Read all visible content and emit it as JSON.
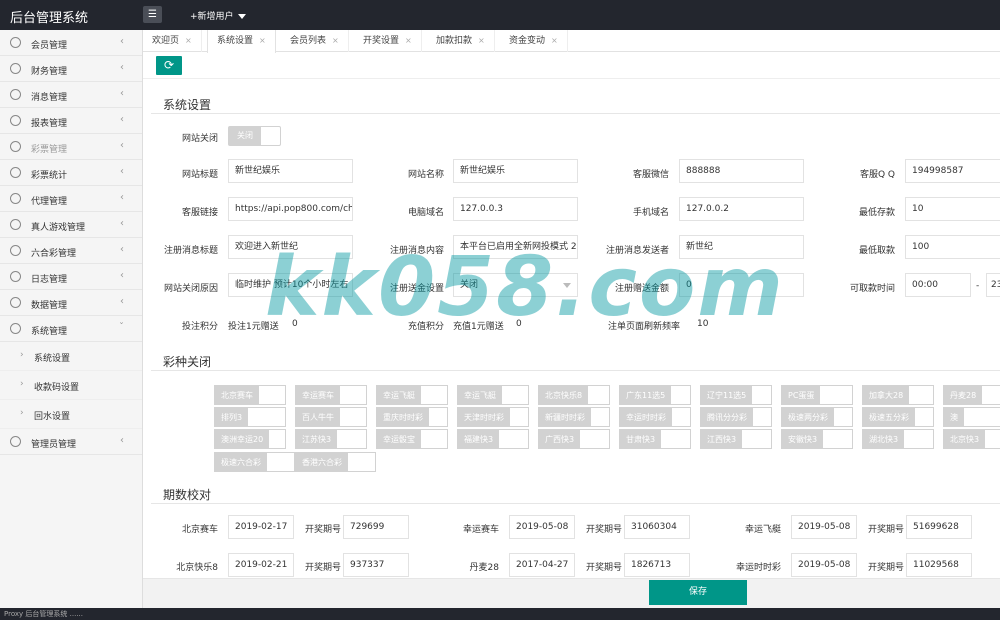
{
  "app": {
    "title": "后台管理系统",
    "add_user": "+新增用户"
  },
  "sidebar": {
    "items": [
      {
        "label": "会员管理"
      },
      {
        "label": "财务管理"
      },
      {
        "label": "消息管理"
      },
      {
        "label": "报表管理"
      },
      {
        "label": "彩票管理"
      },
      {
        "label": "彩票统计"
      },
      {
        "label": "代理管理"
      },
      {
        "label": "真人游戏管理"
      },
      {
        "label": "六合彩管理"
      },
      {
        "label": "日志管理"
      },
      {
        "label": "数据管理"
      },
      {
        "label": "系统管理"
      },
      {
        "label": "系统设置"
      },
      {
        "label": "收款码设置"
      },
      {
        "label": "回水设置"
      },
      {
        "label": "管理员管理"
      }
    ]
  },
  "tabs": [
    {
      "label": "欢迎页"
    },
    {
      "label": "系统设置"
    },
    {
      "label": "会员列表"
    },
    {
      "label": "开奖设置"
    },
    {
      "label": "加款扣款"
    },
    {
      "label": "资金变动"
    }
  ],
  "tab_close": "×",
  "refresh": "⟳",
  "settings": {
    "title": "系统设置",
    "site_close": {
      "label": "网站关闭",
      "value": "关闭"
    },
    "fields": [
      {
        "label": "网站标题",
        "value": "新世纪娱乐"
      },
      {
        "label": "网站名称",
        "value": "新世纪娱乐"
      },
      {
        "label": "客服微信",
        "value": "888888"
      },
      {
        "label": "客服Q Q",
        "value": "194998587"
      },
      {
        "label": "客服链接",
        "value": "https://api.pop800.com/chat/i"
      },
      {
        "label": "电脑域名",
        "value": "127.0.0.3"
      },
      {
        "label": "手机域名",
        "value": "127.0.0.2"
      },
      {
        "label": "最低存款",
        "value": "10"
      },
      {
        "label": "注册消息标题",
        "value": "欢迎进入新世纪"
      },
      {
        "label": "注册消息内容",
        "value": "本平台已启用全新网投模式 2"
      },
      {
        "label": "注册消息发送者",
        "value": "新世纪"
      },
      {
        "label": "最低取款",
        "value": "100"
      },
      {
        "label": "网站关闭原因",
        "value": "临时维护 预计10个小时左右"
      },
      {
        "label": "注册送金设置",
        "value": "关闭"
      },
      {
        "label": "注册赠送金额",
        "value": "0"
      },
      {
        "label": "可取款时间",
        "value": "00:00",
        "sep": "-",
        "value2": "23"
      }
    ],
    "points": [
      {
        "label": "投注积分",
        "prefix": "投注1元赠送",
        "value": "0"
      },
      {
        "label": "充值积分",
        "prefix": "充值1元赠送",
        "value": "0"
      },
      {
        "label": "注单页面刷新频率",
        "value": "10"
      }
    ]
  },
  "lottery": {
    "title": "彩种关闭",
    "rows": [
      [
        "北京赛车",
        "幸运赛车",
        "幸运飞艇",
        "幸运飞艇",
        "北京快乐8",
        "广东11选5",
        "辽宁11选5",
        "PC蛋蛋",
        "加拿大28",
        "丹麦28"
      ],
      [
        "排列3",
        "百人牛牛",
        "重庆时时彩",
        "天津时时彩",
        "新疆时时彩",
        "幸运时时彩",
        "腾讯分分彩",
        "极速两分彩",
        "极速五分彩",
        "澳"
      ],
      [
        "澳洲幸运20",
        "江苏快3",
        "幸运骰宝",
        "福建快3",
        "广西快3",
        "甘肃快3",
        "江西快3",
        "安徽快3",
        "湖北快3",
        "北京快3",
        ""
      ],
      [
        "极速六合彩",
        "香港六合彩"
      ]
    ]
  },
  "periods": {
    "title": "期数校对",
    "issue_label": "开奖期号",
    "rows": [
      [
        {
          "name": "北京赛车",
          "date": "2019-02-17",
          "issue": "729699"
        },
        {
          "name": "幸运赛车",
          "date": "2019-05-08",
          "issue": "31060304"
        },
        {
          "name": "幸运飞艇",
          "date": "2019-05-08",
          "issue": "51699628"
        }
      ],
      [
        {
          "name": "北京快乐8",
          "date": "2019-02-21",
          "issue": "937337"
        },
        {
          "name": "丹麦28",
          "date": "2017-04-27",
          "issue": "1826713"
        },
        {
          "name": "幸运时时彩",
          "date": "2019-05-08",
          "issue": "11029568"
        }
      ]
    ]
  },
  "save": "保存",
  "watermark": "kk058.com",
  "status_text": "Proxy 后台管理系统 ......"
}
